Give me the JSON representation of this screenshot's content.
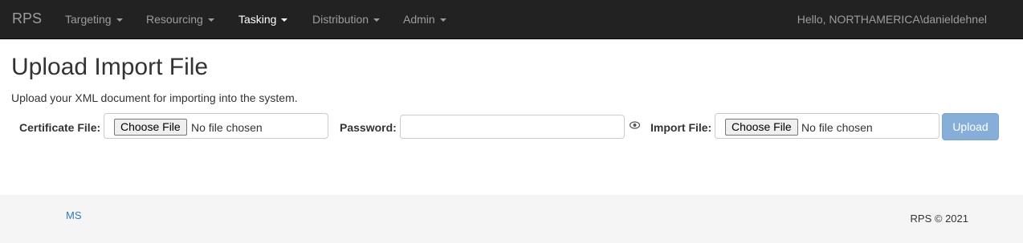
{
  "navbar": {
    "brand": "RPS",
    "items": [
      {
        "label": "Targeting"
      },
      {
        "label": "Resourcing"
      },
      {
        "label": "Tasking"
      },
      {
        "label": "Distribution"
      },
      {
        "label": "Admin"
      }
    ],
    "active_item": "Tasking",
    "greeting": "Hello, NORTHAMERICA\\danieldehnel"
  },
  "page": {
    "title": "Upload Import File",
    "description": "Upload your XML document for importing into the system."
  },
  "form": {
    "certificate_label": "Certificate File:",
    "certificate_button": "Choose File",
    "certificate_status": "No file chosen",
    "password_label": "Password:",
    "password_value": "",
    "import_label": "Import File:",
    "import_button": "Choose File",
    "import_status": "No file chosen",
    "upload_label": "Upload"
  },
  "footer": {
    "link": "MS",
    "copyright": "RPS © 2021"
  },
  "colors": {
    "navbar_bg": "#222222",
    "primary": "#337ab7",
    "upload_disabled": "#85aed8"
  },
  "icons": [
    "caret-down-icon",
    "eye-icon"
  ]
}
